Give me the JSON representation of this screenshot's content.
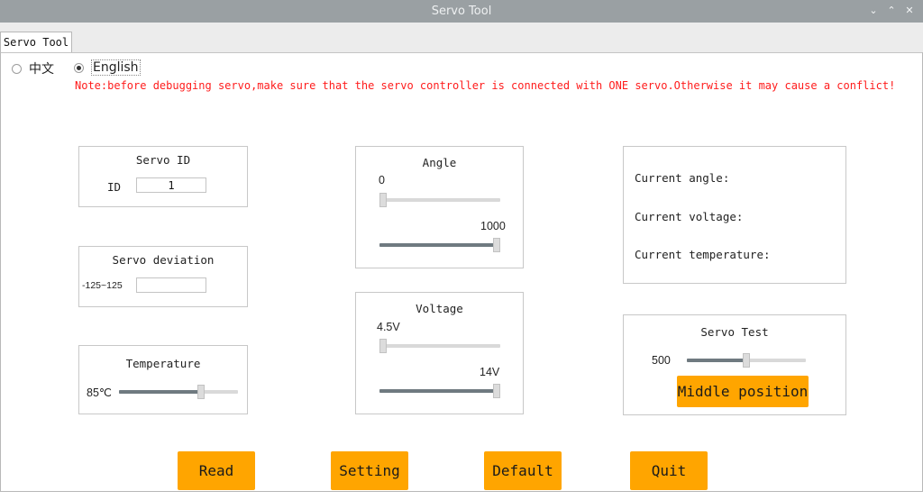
{
  "window": {
    "title": "Servo Tool",
    "minimize_icon": "chevron-down",
    "maximize_icon": "chevron-up",
    "close_icon": "x"
  },
  "tabs": [
    {
      "label": "Servo Tool"
    }
  ],
  "language": {
    "options": [
      {
        "label": "中文",
        "selected": false
      },
      {
        "label": "English",
        "selected": true
      }
    ]
  },
  "note": "Note:before debugging servo,make sure that the servo controller is connected with ONE servo.Otherwise it may cause a conflict!",
  "servo_id": {
    "title": "Servo ID",
    "label": "ID",
    "value": "1"
  },
  "servo_deviation": {
    "title": "Servo deviation",
    "range_label": "-125~125",
    "value": ""
  },
  "temperature": {
    "title": "Temperature",
    "value_label": "85℃",
    "slider_level": 0.7
  },
  "angle": {
    "title": "Angle",
    "min_label": "0",
    "max_label": "1000",
    "min_slider_level": 0.0,
    "max_slider_level": 1.0
  },
  "voltage": {
    "title": "Voltage",
    "min_label": "4.5V",
    "max_label": "14V",
    "min_slider_level": 0.0,
    "max_slider_level": 1.0
  },
  "status": {
    "current_angle": "Current angle:",
    "current_voltage": "Current voltage:",
    "current_temperature": "Current temperature:"
  },
  "servo_test": {
    "title": "Servo Test",
    "value_label": "500",
    "slider_level": 0.5,
    "middle_button": "Middle position"
  },
  "buttons": {
    "read": "Read",
    "setting": "Setting",
    "default": "Default",
    "quit": "Quit"
  },
  "colors": {
    "accent": "#ffa500",
    "warning_text": "#ff1c1c",
    "titlebar": "#9aa0a3"
  }
}
